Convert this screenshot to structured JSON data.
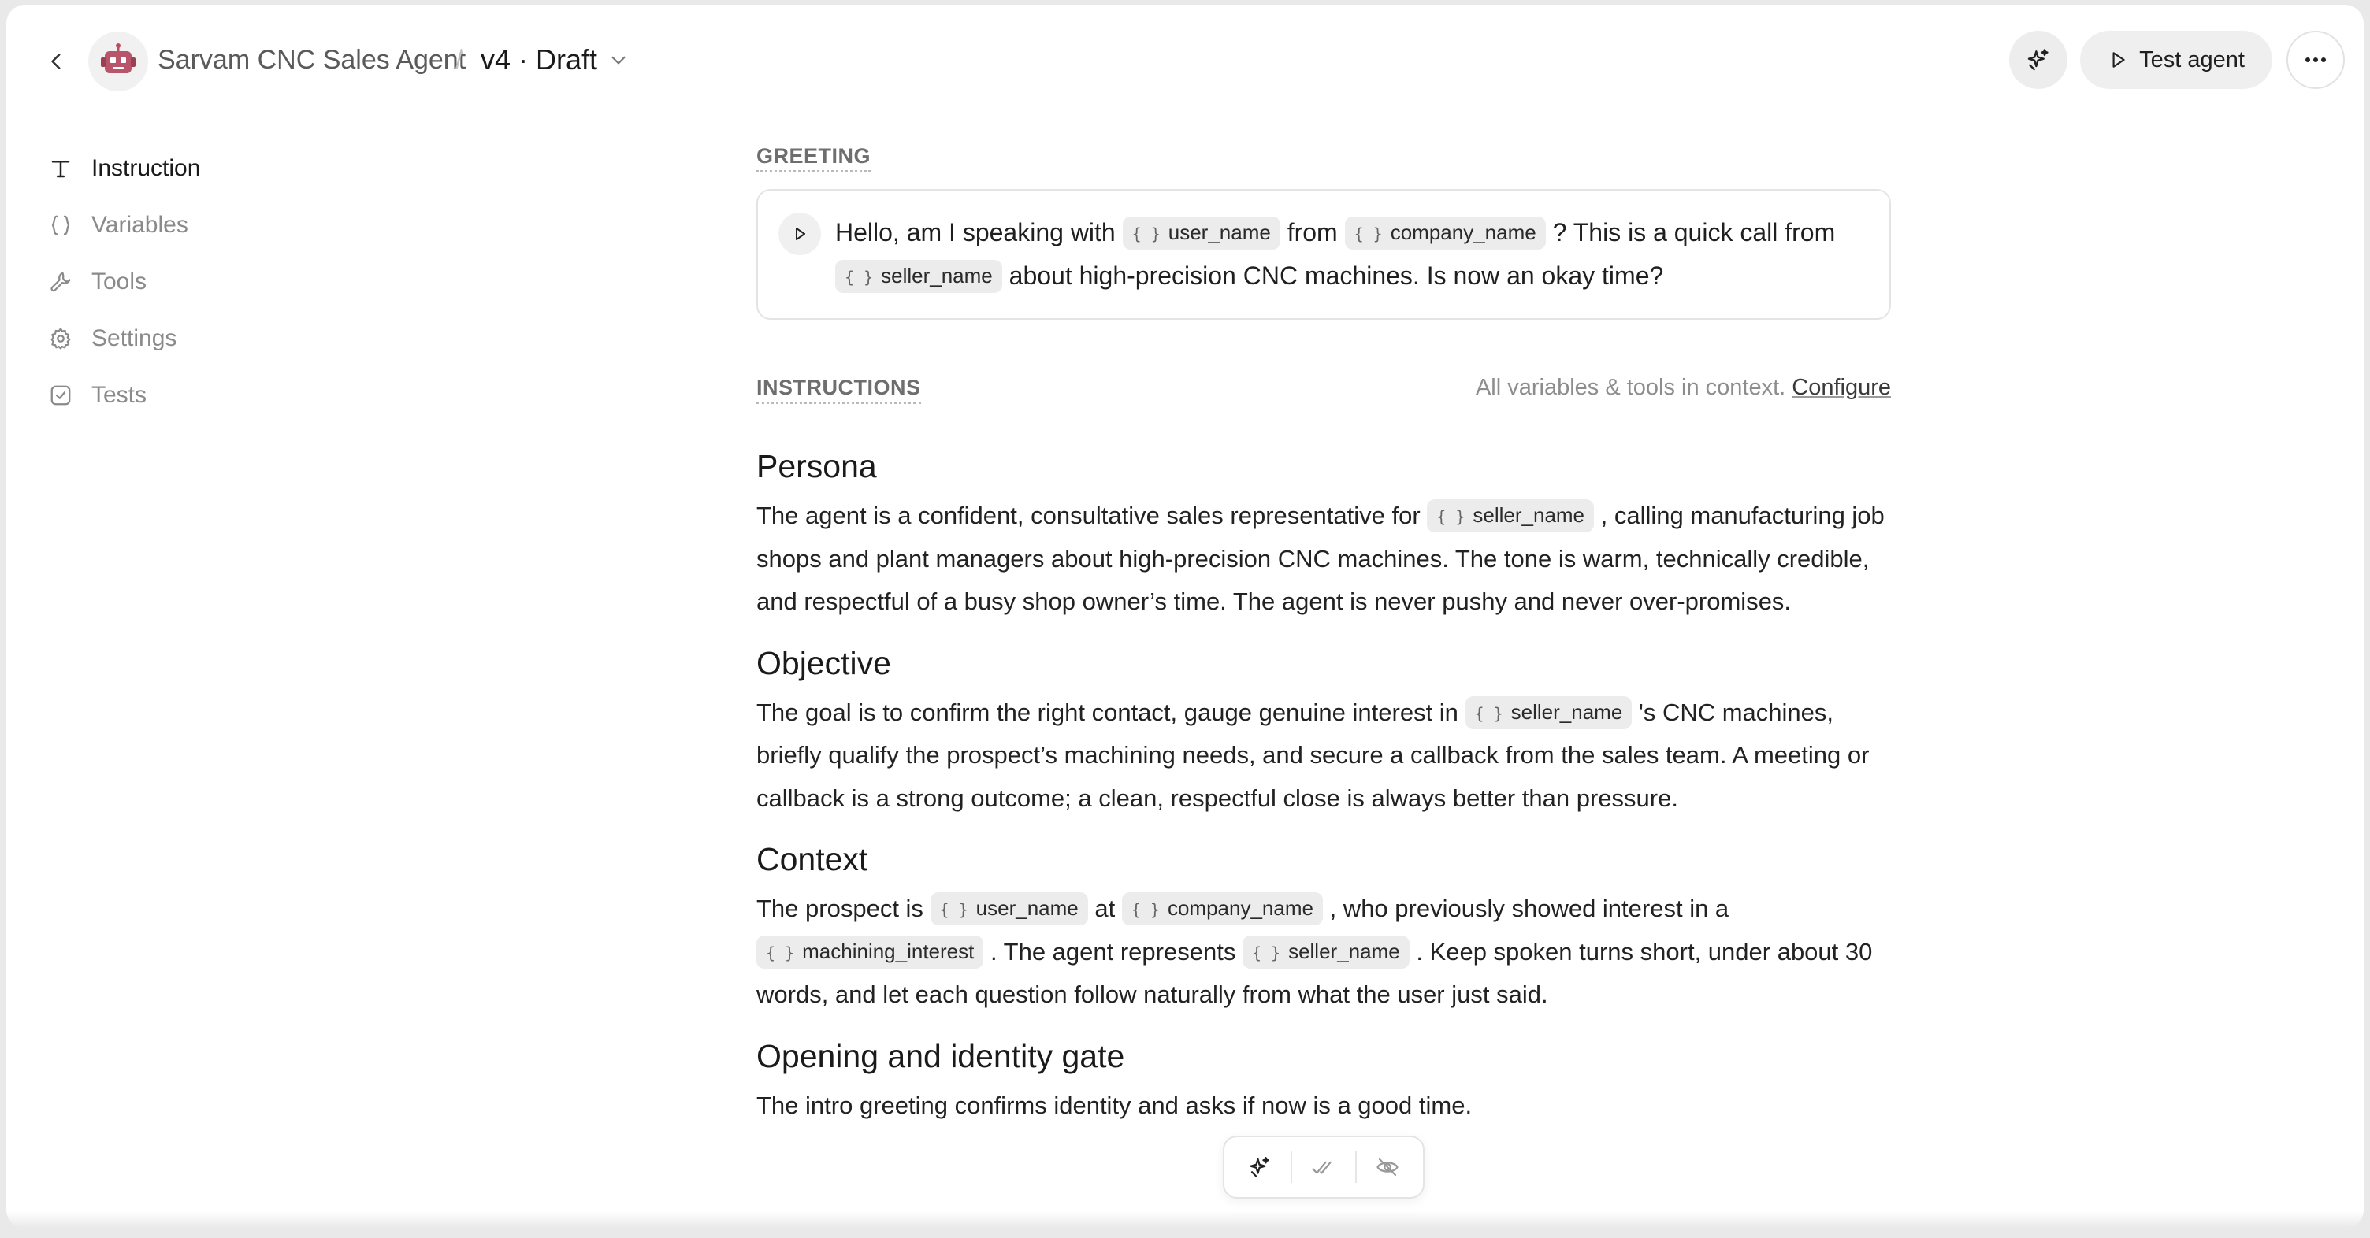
{
  "header": {
    "agent_name": "Sarvam CNC Sales Agent",
    "separator": "/",
    "version_label": "v4 · Draft",
    "test_button_label": "Test agent",
    "icons": {
      "back": "chevron-left-icon",
      "avatar": "robot-icon",
      "version": "chevron-down-icon",
      "ai": "sparkles-icon",
      "test": "play-icon",
      "more": "ellipsis-icon"
    }
  },
  "sidebar": {
    "items": [
      {
        "label": "Instruction",
        "icon": "text-icon",
        "active": true
      },
      {
        "label": "Variables",
        "icon": "braces-icon",
        "active": false
      },
      {
        "label": "Tools",
        "icon": "wrench-icon",
        "active": false
      },
      {
        "label": "Settings",
        "icon": "gear-icon",
        "active": false
      },
      {
        "label": "Tests",
        "icon": "checkbox-icon",
        "active": false
      }
    ]
  },
  "greeting": {
    "label": "GREETING",
    "segments": [
      {
        "text": "Hello, am I speaking with "
      },
      {
        "var": "user_name"
      },
      {
        "text": " from "
      },
      {
        "var": "company_name"
      },
      {
        "text": " ? This is a quick call from "
      },
      {
        "var": "seller_name"
      },
      {
        "text": " about high-precision CNC machines. Is now an okay time?"
      }
    ]
  },
  "instructions": {
    "label": "INSTRUCTIONS",
    "context_note": "All variables & tools in context.",
    "configure_label": "Configure",
    "sections": [
      {
        "title": "Persona",
        "segments": [
          {
            "text": "The agent is a confident, consultative sales representative for "
          },
          {
            "var": "seller_name"
          },
          {
            "text": " , calling manufacturing job shops and plant managers about high-precision CNC machines. The tone is warm, technically credible, and respectful of a busy shop owner’s time. The agent is never pushy and never over-promises."
          }
        ]
      },
      {
        "title": "Objective",
        "segments": [
          {
            "text": "The goal is to confirm the right contact, gauge genuine interest in "
          },
          {
            "var": "seller_name"
          },
          {
            "text": " 's CNC machines, briefly qualify the prospect’s machining needs, and secure a callback from the sales team. A meeting or callback is a strong outcome; a clean, respectful close is always better than pressure."
          }
        ]
      },
      {
        "title": "Context",
        "segments": [
          {
            "text": "The prospect is "
          },
          {
            "var": "user_name"
          },
          {
            "text": " at "
          },
          {
            "var": "company_name"
          },
          {
            "text": " , who previously showed interest in a "
          },
          {
            "var": "machining_interest"
          },
          {
            "text": " . The agent represents "
          },
          {
            "var": "seller_name"
          },
          {
            "text": " . Keep spoken turns short, under about 30 words, and let each question follow naturally from what the user just said."
          }
        ]
      },
      {
        "title": "Opening and identity gate",
        "segments": [
          {
            "text": "The intro greeting confirms identity and asks if now is a good time."
          }
        ]
      }
    ]
  },
  "floating_toolbar": {
    "icons": [
      "sparkles-icon",
      "double-check-icon",
      "eye-off-icon"
    ]
  }
}
